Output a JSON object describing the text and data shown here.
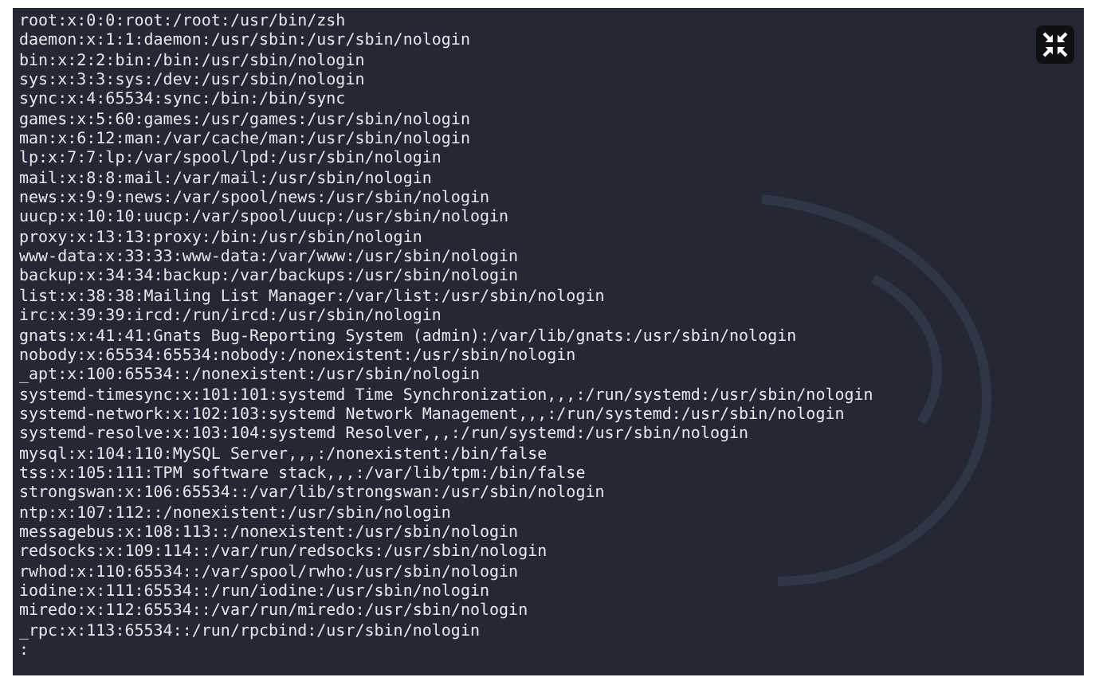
{
  "terminal": {
    "lines": [
      "root:x:0:0:root:/root:/usr/bin/zsh",
      "daemon:x:1:1:daemon:/usr/sbin:/usr/sbin/nologin",
      "bin:x:2:2:bin:/bin:/usr/sbin/nologin",
      "sys:x:3:3:sys:/dev:/usr/sbin/nologin",
      "sync:x:4:65534:sync:/bin:/bin/sync",
      "games:x:5:60:games:/usr/games:/usr/sbin/nologin",
      "man:x:6:12:man:/var/cache/man:/usr/sbin/nologin",
      "lp:x:7:7:lp:/var/spool/lpd:/usr/sbin/nologin",
      "mail:x:8:8:mail:/var/mail:/usr/sbin/nologin",
      "news:x:9:9:news:/var/spool/news:/usr/sbin/nologin",
      "uucp:x:10:10:uucp:/var/spool/uucp:/usr/sbin/nologin",
      "proxy:x:13:13:proxy:/bin:/usr/sbin/nologin",
      "www-data:x:33:33:www-data:/var/www:/usr/sbin/nologin",
      "backup:x:34:34:backup:/var/backups:/usr/sbin/nologin",
      "list:x:38:38:Mailing List Manager:/var/list:/usr/sbin/nologin",
      "irc:x:39:39:ircd:/run/ircd:/usr/sbin/nologin",
      "gnats:x:41:41:Gnats Bug-Reporting System (admin):/var/lib/gnats:/usr/sbin/nologin",
      "nobody:x:65534:65534:nobody:/nonexistent:/usr/sbin/nologin",
      "_apt:x:100:65534::/nonexistent:/usr/sbin/nologin",
      "systemd-timesync:x:101:101:systemd Time Synchronization,,,:/run/systemd:/usr/sbin/nologin",
      "systemd-network:x:102:103:systemd Network Management,,,:/run/systemd:/usr/sbin/nologin",
      "systemd-resolve:x:103:104:systemd Resolver,,,:/run/systemd:/usr/sbin/nologin",
      "mysql:x:104:110:MySQL Server,,,:/nonexistent:/bin/false",
      "tss:x:105:111:TPM software stack,,,:/var/lib/tpm:/bin/false",
      "strongswan:x:106:65534::/var/lib/strongswan:/usr/sbin/nologin",
      "ntp:x:107:112::/nonexistent:/usr/sbin/nologin",
      "messagebus:x:108:113::/nonexistent:/usr/sbin/nologin",
      "redsocks:x:109:114::/var/run/redsocks:/usr/sbin/nologin",
      "rwhod:x:110:65534::/var/spool/rwho:/usr/sbin/nologin",
      "iodine:x:111:65534::/run/iodine:/usr/sbin/nologin",
      "miredo:x:112:65534::/var/run/miredo:/usr/sbin/nologin",
      "_rpc:x:113:65534::/run/rpcbind:/usr/sbin/nologin"
    ],
    "prompt": ":"
  }
}
